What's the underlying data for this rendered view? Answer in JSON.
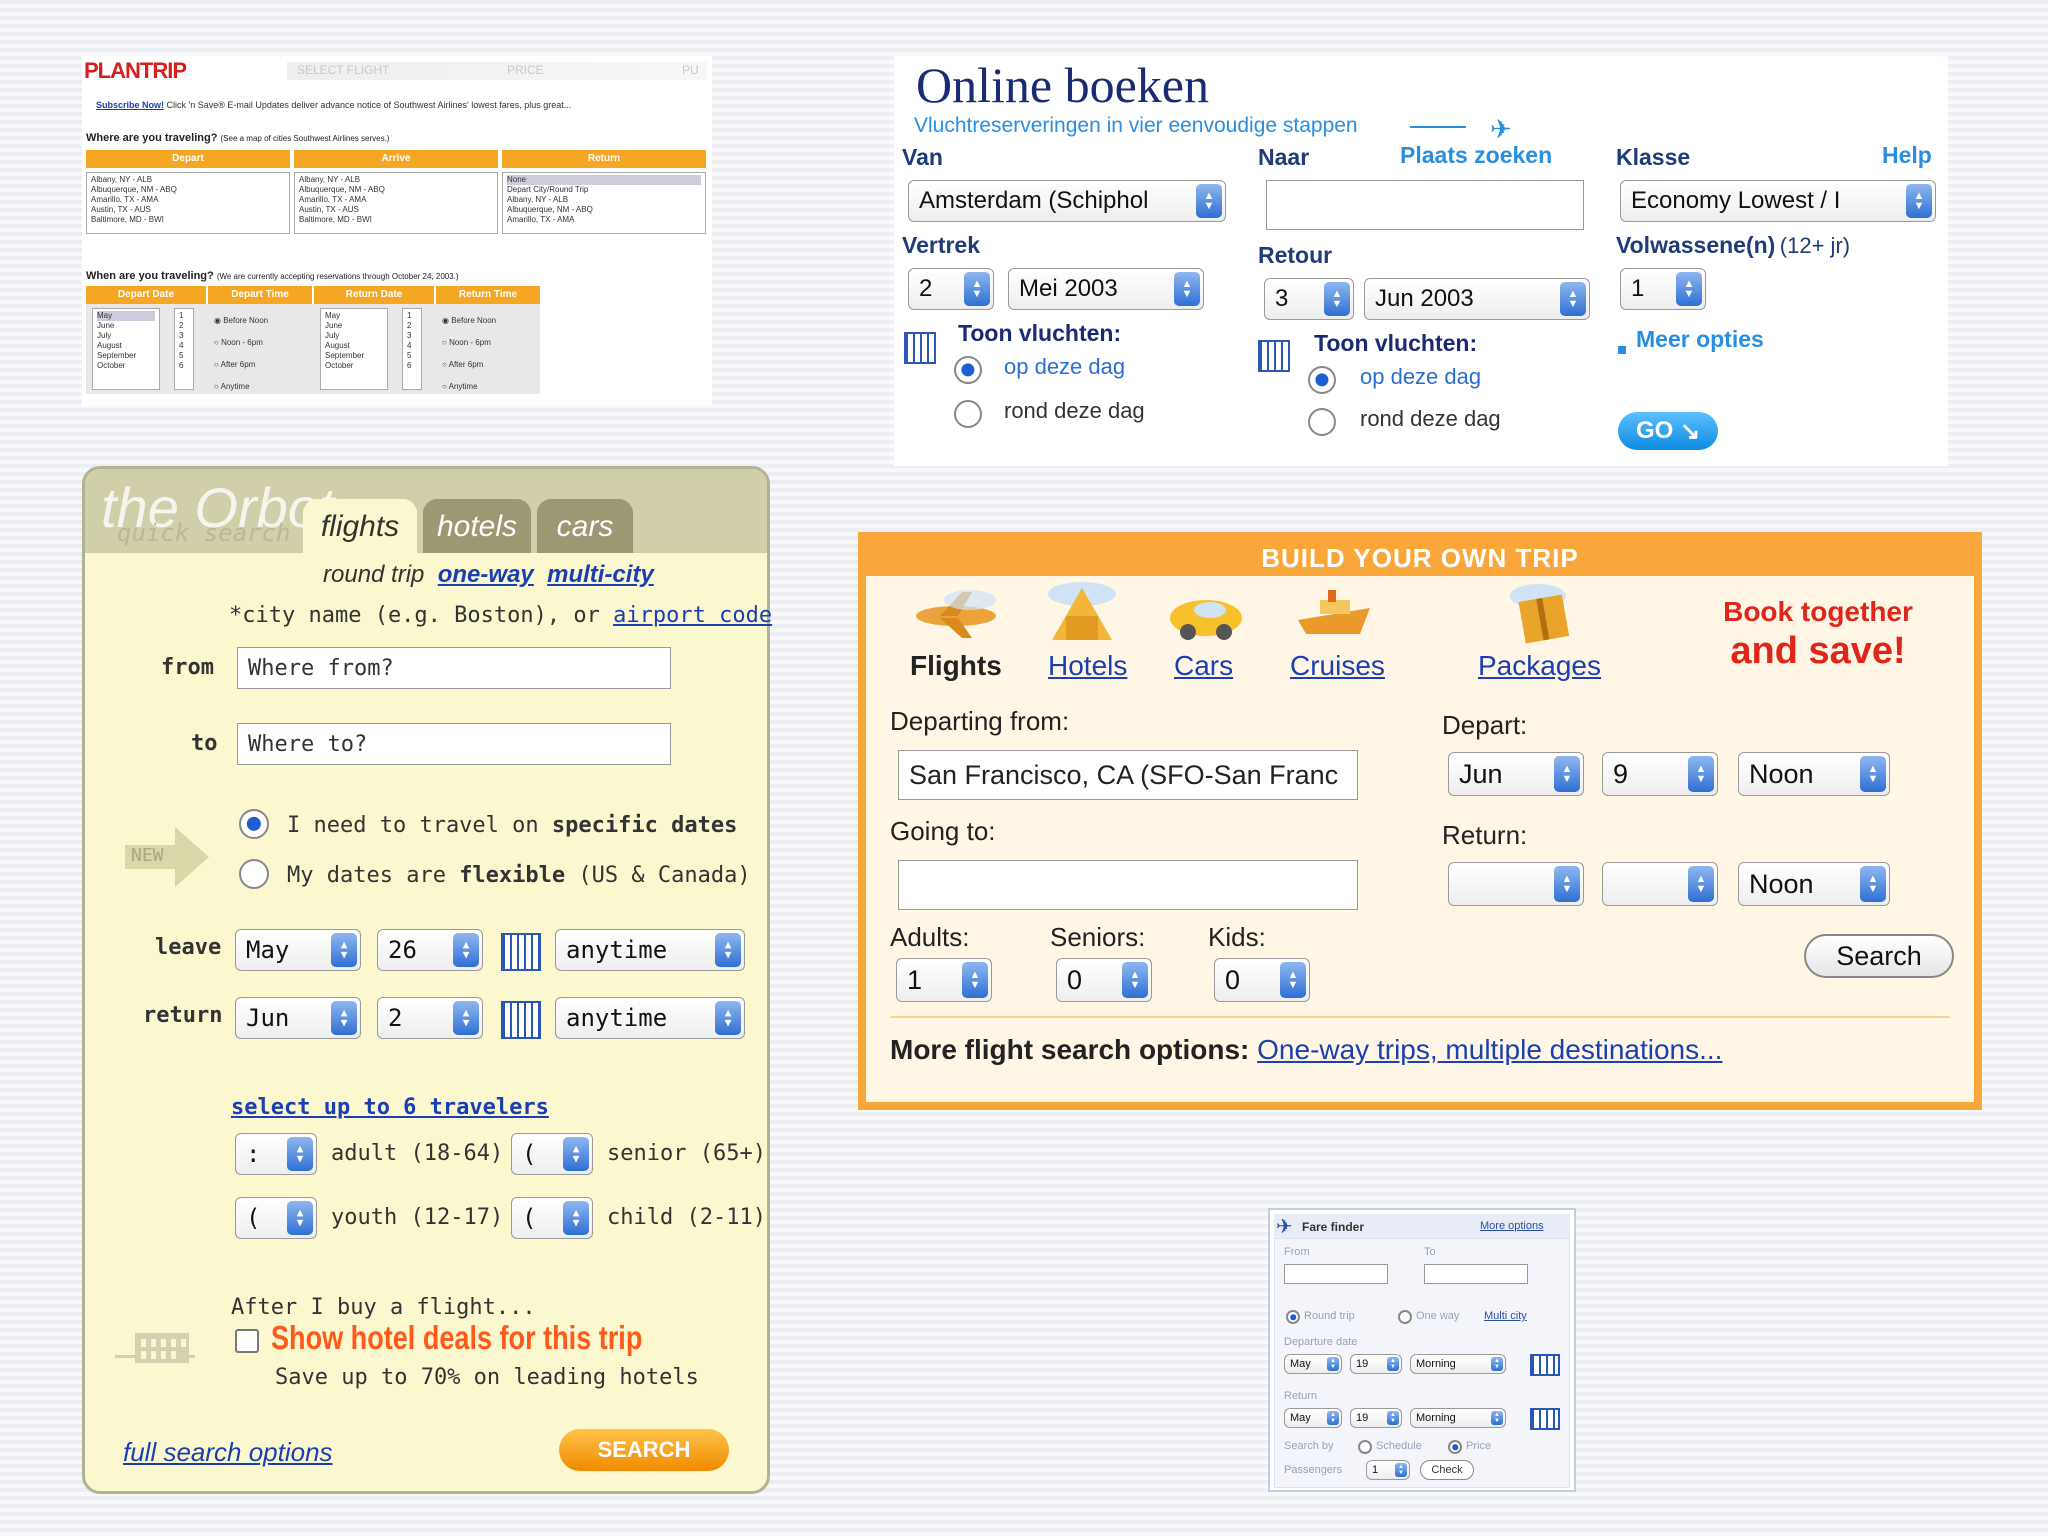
{
  "plantrip": {
    "logo": "PLANTRIP",
    "steps": [
      "SELECT FLIGHT",
      "PRICE",
      "PU"
    ],
    "subscribe_link": "Subscribe Now!",
    "subscribe_text": "Click 'n Save® E-mail Updates deliver advance notice of Southwest Airlines' lowest fares, plus great...",
    "where_q": "Where are you traveling?",
    "where_note": "(See a map of cities Southwest Airlines serves.)",
    "headers": [
      "Depart",
      "Arrive",
      "Return"
    ],
    "depart_cities": [
      "Albany, NY - ALB",
      "Albuquerque, NM - ABQ",
      "Amarillo, TX - AMA",
      "Austin, TX - AUS",
      "Baltimore, MD - BWI"
    ],
    "arrive_cities": [
      "Albany, NY - ALB",
      "Albuquerque, NM - ABQ",
      "Amarillo, TX - AMA",
      "Austin, TX - AUS",
      "Baltimore, MD - BWI"
    ],
    "return_cities": [
      "None",
      "Depart City/Round Trip",
      "Albany, NY - ALB",
      "Albuquerque, NM - ABQ",
      "Amarillo, TX - AMA"
    ],
    "when_q": "When are you traveling?",
    "when_note": "(We are currently accepting reservations through October 24, 2003.)",
    "date_headers": [
      "Depart Date",
      "Depart Time",
      "Return Date",
      "Return Time"
    ],
    "months": [
      "May",
      "June",
      "July",
      "August",
      "September",
      "October"
    ],
    "days": [
      "1",
      "2",
      "3",
      "4",
      "5",
      "6"
    ],
    "times": [
      "Before Noon",
      "Noon - 6pm",
      "After 6pm",
      "Anytime"
    ]
  },
  "boeken": {
    "title": "Online boeken",
    "subtitle": "Vluchtreserveringen in vier eenvoudige stappen",
    "van_label": "Van",
    "van_value": "Amsterdam (Schiphol",
    "naar_label": "Naar",
    "plaats_zoeken": "Plaats zoeken",
    "naar_value": "",
    "klasse_label": "Klasse",
    "help": "Help",
    "klasse_value": "Economy Lowest / I",
    "vertrek_label": "Vertrek",
    "vertrek_day": "2",
    "vertrek_month": "Mei 2003",
    "retour_label": "Retour",
    "retour_day": "3",
    "retour_month": "Jun 2003",
    "volwassenen_label": "Volwassene(n)",
    "volwassenen_note": "(12+ jr)",
    "volwassenen_value": "1",
    "toon_vluchten": "Toon vluchten:",
    "op_deze_dag": "op deze dag",
    "rond_deze_dag": "rond deze dag",
    "meer_opties": "Meer opties",
    "go": "GO"
  },
  "orbitz": {
    "logo": "the Orbot",
    "logo_sub": "quick search",
    "tabs": [
      "flights",
      "hotels",
      "cars"
    ],
    "trip_round": "round trip",
    "trip_oneway": "one-way",
    "trip_multi": "multi-city",
    "city_hint": "*city name (e.g. Boston), or",
    "airport_code": "airport code",
    "from_label": "from",
    "from_value": "Where from?",
    "to_label": "to",
    "to_value": "Where to?",
    "new_badge": "NEW",
    "specific_pre": "I need to travel on ",
    "specific_bold": "specific dates",
    "flexible_pre": "My dates are ",
    "flexible_bold": "flexible",
    "flexible_post": " (US & Canada)",
    "leave_label": "leave",
    "leave_month": "May",
    "leave_day": "26",
    "leave_time": "anytime",
    "return_label": "return",
    "return_month": "Jun",
    "return_day": "2",
    "return_time": "anytime",
    "travelers_link": "select up to 6 travelers",
    "adult_value": ":",
    "adult_label": "adult (18-64)",
    "senior_value": "(",
    "senior_label": "senior (65+)",
    "youth_value": "(",
    "youth_label": "youth (12-17)",
    "child_value": "(",
    "child_label": "child (2-11)",
    "after_buy": "After I buy a flight...",
    "hotel_deals": "Show hotel deals for this trip",
    "save_up": "Save up to 70% on leading hotels",
    "full_search": "full search options",
    "search": "SEARCH"
  },
  "build": {
    "header": "BUILD YOUR OWN TRIP",
    "categories": [
      "Flights",
      "Hotels",
      "Cars",
      "Cruises",
      "Packages"
    ],
    "promo_line1": "Book together",
    "promo_line2": "and save!",
    "departing_label": "Departing from:",
    "departing_value": "San Francisco, CA (SFO-San Franc",
    "going_label": "Going to:",
    "going_value": "",
    "depart_label": "Depart:",
    "depart_month": "Jun",
    "depart_day": "9",
    "depart_time": "Noon",
    "return_label": "Return:",
    "return_month": "",
    "return_day": "",
    "return_time": "Noon",
    "adults_label": "Adults:",
    "adults_value": "1",
    "seniors_label": "Seniors:",
    "seniors_value": "0",
    "kids_label": "Kids:",
    "kids_value": "0",
    "search": "Search",
    "more_label": "More flight search options:",
    "more_link": "One-way trips, multiple destinations..."
  },
  "farefinder": {
    "title": "Fare finder",
    "more_options": "More options",
    "from_label": "From",
    "to_label": "To",
    "round_trip": "Round trip",
    "one_way": "One way",
    "multi_city": "Multi city",
    "departure_date": "Departure date",
    "dep_month": "May",
    "dep_day": "19",
    "dep_time": "Morning",
    "return_label": "Return",
    "ret_month": "May",
    "ret_day": "19",
    "ret_time": "Morning",
    "search_by": "Search by",
    "schedule": "Schedule",
    "price": "Price",
    "passengers": "Passengers",
    "passengers_value": "1",
    "check": "Check"
  }
}
